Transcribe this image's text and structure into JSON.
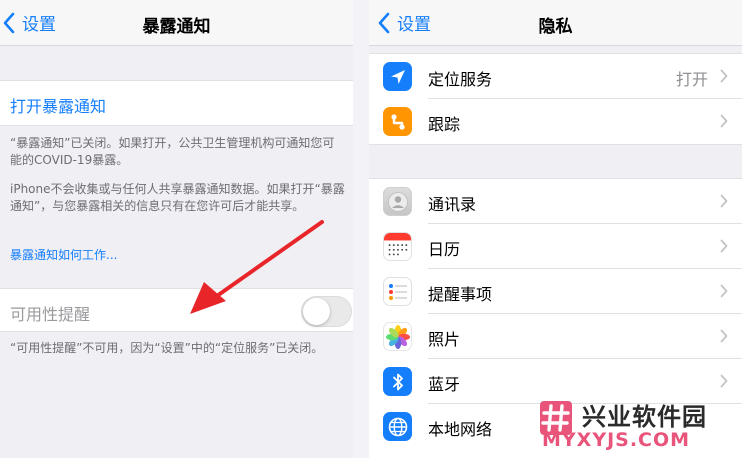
{
  "left": {
    "back_label": "设置",
    "title": "暴露通知",
    "open_link": "打开暴露通知",
    "desc1": "“暴露通知”已关闭。如果打开，公共卫生管理机构可通知您可能的COVID-19暴露。",
    "desc2": "iPhone不会收集或与任何人共享暴露通知数据。如果打开“暴露通知”，与您暴露相关的信息只有在您许可后才能共享。",
    "learn_link": "暴露通知如何工作...",
    "availability_label": "可用性提醒",
    "availability_on": false,
    "desc3": "“可用性提醒”不可用，因为“设置”中的“定位服务”已关闭。"
  },
  "right": {
    "back_label": "设置",
    "title": "隐私",
    "group1": [
      {
        "label": "定位服务",
        "value": "打开",
        "icon": "location-icon",
        "color": "#147efb"
      },
      {
        "label": "跟踪",
        "value": "",
        "icon": "tracking-icon",
        "color": "#ff9500"
      }
    ],
    "group2": [
      {
        "label": "通讯录",
        "icon": "contacts-icon"
      },
      {
        "label": "日历",
        "icon": "calendar-icon"
      },
      {
        "label": "提醒事项",
        "icon": "reminders-icon"
      },
      {
        "label": "照片",
        "icon": "photos-icon"
      },
      {
        "label": "蓝牙",
        "icon": "bluetooth-icon",
        "color": "#147efb"
      },
      {
        "label": "本地网络",
        "icon": "local-network-icon",
        "color": "#147efb"
      }
    ]
  },
  "watermark": {
    "cn": "兴业软件园",
    "en": "MYXYJS.COM"
  }
}
